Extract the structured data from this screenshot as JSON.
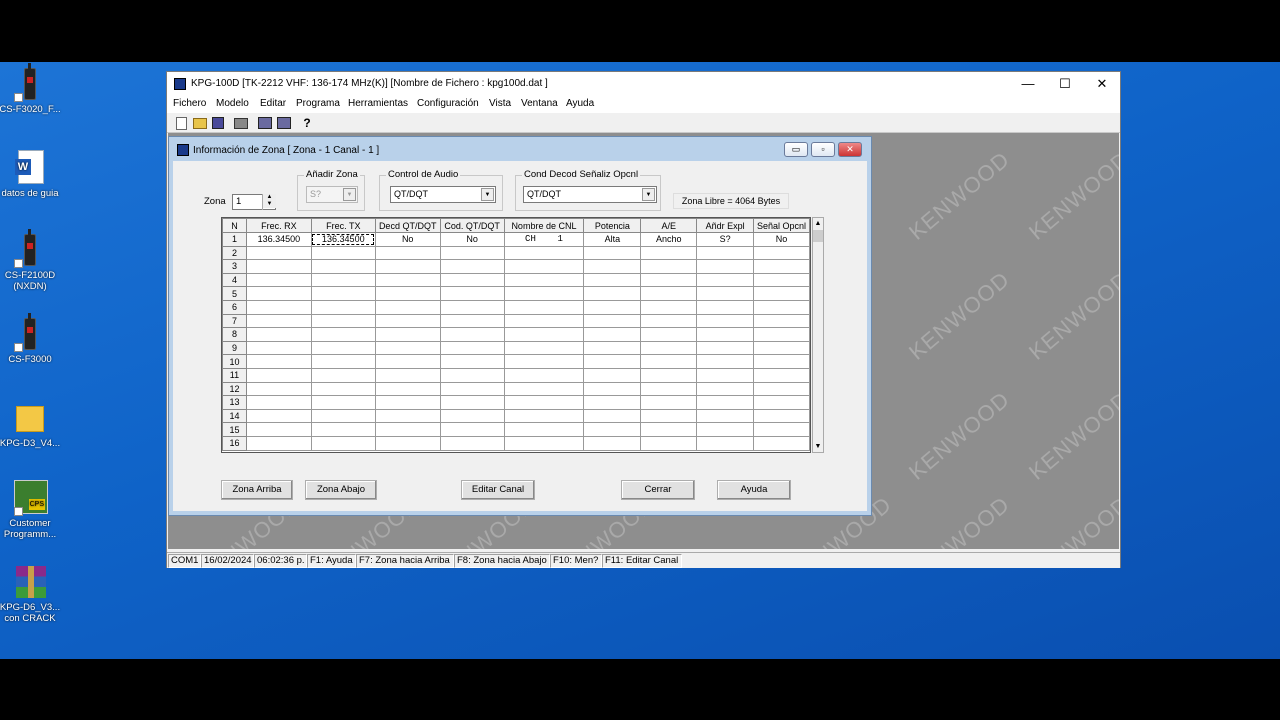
{
  "desktop": {
    "icons": [
      {
        "label": "CS-F3020_F...",
        "icon": "radio-shortcut-icon"
      },
      {
        "label": "datos de guia",
        "icon": "word-document-icon"
      },
      {
        "label": "CS-F2100D (NXDN)",
        "icon": "radio-document-icon"
      },
      {
        "label": "CS-F3000",
        "icon": "radio-shortcut-icon"
      },
      {
        "label": "KPG-D3_V4...",
        "icon": "folder-icon"
      },
      {
        "label": "Customer Programm...",
        "icon": "cps-shortcut-icon"
      },
      {
        "label": "KPG-D6_V3... con CRACK",
        "icon": "winrar-archive-icon"
      }
    ]
  },
  "window": {
    "title": "KPG-100D [TK-2212 VHF: 136-174 MHz(K)] [Nombre de Fichero : kpg100d.dat ]",
    "controls": {
      "minimize": "—",
      "maximize": "☐",
      "close": "✕"
    },
    "menu": [
      "Fichero",
      "Modelo",
      "Editar",
      "Programa",
      "Herramientas",
      "Configuración",
      "Vista",
      "Ventana",
      "Ayuda"
    ],
    "toolbar": [
      "new-file-icon",
      "open-folder-icon",
      "save-icon",
      "print-icon",
      "read-radio-icon",
      "write-radio-icon",
      "help-icon"
    ],
    "help_glyph": "?",
    "watermark": "KENWOOD"
  },
  "dialog": {
    "title": "Información de Zona [ Zona - 1   Canal - 1 ]",
    "controls": {
      "minimize": "▭",
      "restore": "▫",
      "close": "✕"
    },
    "zona_label": "Zona",
    "zona_value": "1",
    "add_zone": {
      "label": "Añadir Zona",
      "value": "S?"
    },
    "audio_control": {
      "label": "Control de Audio",
      "value": "QT/DQT"
    },
    "cond_decod": {
      "label": "Cond Decod Señaliz Opcnl",
      "value": "QT/DQT"
    },
    "free_zone": "Zona Libre = 4064 Bytes",
    "columns": [
      "N",
      "Frec. RX",
      "Frec. TX",
      "Decd QT/DQT",
      "Cod. QT/DQT",
      "Nombre de CNL",
      "Potencia",
      "A/E",
      "Añdr Expl",
      "Señal Opcnl"
    ],
    "rows": [
      [
        "1",
        "136.34500",
        "136.34500",
        "No",
        "No",
        "CH    1",
        "Alta",
        "Ancho",
        "S?",
        "No"
      ],
      [
        "2",
        "",
        "",
        "",
        "",
        "",
        "",
        "",
        "",
        ""
      ],
      [
        "3",
        "",
        "",
        "",
        "",
        "",
        "",
        "",
        "",
        ""
      ],
      [
        "4",
        "",
        "",
        "",
        "",
        "",
        "",
        "",
        "",
        ""
      ],
      [
        "5",
        "",
        "",
        "",
        "",
        "",
        "",
        "",
        "",
        ""
      ],
      [
        "6",
        "",
        "",
        "",
        "",
        "",
        "",
        "",
        "",
        ""
      ],
      [
        "7",
        "",
        "",
        "",
        "",
        "",
        "",
        "",
        "",
        ""
      ],
      [
        "8",
        "",
        "",
        "",
        "",
        "",
        "",
        "",
        "",
        ""
      ],
      [
        "9",
        "",
        "",
        "",
        "",
        "",
        "",
        "",
        "",
        ""
      ],
      [
        "10",
        "",
        "",
        "",
        "",
        "",
        "",
        "",
        "",
        ""
      ],
      [
        "11",
        "",
        "",
        "",
        "",
        "",
        "",
        "",
        "",
        ""
      ],
      [
        "12",
        "",
        "",
        "",
        "",
        "",
        "",
        "",
        "",
        ""
      ],
      [
        "13",
        "",
        "",
        "",
        "",
        "",
        "",
        "",
        "",
        ""
      ],
      [
        "14",
        "",
        "",
        "",
        "",
        "",
        "",
        "",
        "",
        ""
      ],
      [
        "15",
        "",
        "",
        "",
        "",
        "",
        "",
        "",
        "",
        ""
      ],
      [
        "16",
        "",
        "",
        "",
        "",
        "",
        "",
        "",
        "",
        ""
      ]
    ],
    "buttons": {
      "zone_up": "Zona Arriba",
      "zone_down": "Zona Abajo",
      "edit_channel": "Editar Canal",
      "close": "Cerrar",
      "help": "Ayuda"
    }
  },
  "statusbar": [
    "COM1",
    "16/02/2024",
    "06:02:36 p.",
    "F1: Ayuda",
    "F7: Zona hacia Arriba",
    "F8: Zona hacia Abajo",
    "F10: Men?",
    "F11: Editar Canal"
  ],
  "colors": {
    "desktop": "#0f63c8",
    "dialog_border": "#b9d1ea",
    "mdi_bg": "#8e8e8e"
  }
}
